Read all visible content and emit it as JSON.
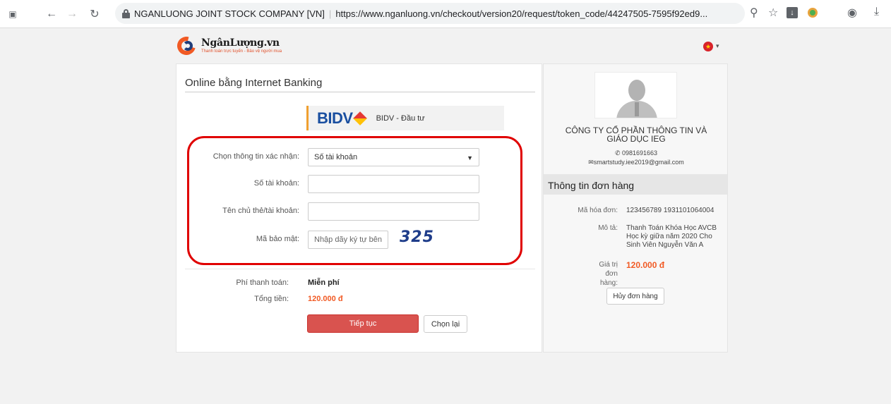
{
  "browser": {
    "site_owner": "NGANLUONG JOINT STOCK COMPANY [VN]",
    "url": "https://www.nganluong.vn/checkout/version20/request/token_code/44247505-7595f92ed9..."
  },
  "brand": {
    "name": "NgânLượng.vn",
    "tagline": "Thanh toán trực tuyến - Bảo vệ người mua"
  },
  "payment": {
    "section_title": "Online bằng Internet Banking",
    "bank_logo": "BIDV",
    "bank_name": "BIDV - Đầu tư"
  },
  "form": {
    "verify_label": "Chọn thông tin xác nhận:",
    "verify_value": "Số tài khoản",
    "account_label": "Số tài khoản:",
    "account_value": "",
    "holder_label": "Tên chủ thẻ/tài khoản:",
    "holder_value": "",
    "captcha_label": "Mã bảo mật:",
    "captcha_placeholder": "Nhập dãy ký tự bên",
    "captcha_code": "325"
  },
  "totals": {
    "fee_label": "Phí thanh toán:",
    "fee_value": "Miễn phí",
    "total_label": "Tổng tiền:",
    "total_value": "120.000 đ"
  },
  "actions": {
    "continue": "Tiếp tục",
    "reselect": "Chọn lại"
  },
  "merchant": {
    "name_line1": "CÔNG TY CỔ PHẦN THÔNG TIN VÀ",
    "name_line2": "GIÁO DỤC IEG",
    "phone": "0981691663",
    "email": "smartstudy.iee2019@gmail.com"
  },
  "order": {
    "header": "Thông tin đơn hàng",
    "invoice_label": "Mã hóa đơn:",
    "invoice_value": "123456789 1931101064004",
    "desc_label": "Mô tả:",
    "desc_value": "Thanh Toán Khóa Học AVCB Học kỳ giữa năm 2020 Cho Sinh Viên Nguyễn Văn A",
    "amount_label": "Giá trị đơn hàng:",
    "amount_value": "120.000 đ",
    "cancel": "Hủy đơn hàng"
  },
  "colors": {
    "accent": "#f15a24",
    "primary_button": "#d9534f",
    "highlight": "#e00000"
  }
}
